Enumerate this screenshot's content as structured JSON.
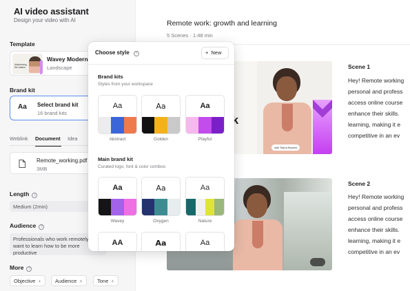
{
  "sidebar": {
    "title": "AI video assistant",
    "subtitle": "Design your video with AI",
    "template": {
      "label": "Template",
      "name": "Wavey Modern",
      "orientation": "Landscape",
      "thumb_text": "Addressing the basics"
    },
    "brand_kit": {
      "label": "Brand kit",
      "aa": "Aa",
      "name": "Select brand kit",
      "count": "16 brand kits"
    },
    "source_tabs": [
      "Weblink",
      "Document",
      "Idea"
    ],
    "active_tab": "Document",
    "file": {
      "name": "Remote_working.pdf",
      "size": "3MB"
    },
    "length": {
      "label": "Length",
      "value": "Medium (2min)"
    },
    "audience": {
      "label": "Audience",
      "value": "Professionals who work remotely and want to learn how to be more productive"
    },
    "more": {
      "label": "More",
      "chips": [
        "Objective",
        "Audience",
        "Tone"
      ]
    }
  },
  "main": {
    "title": "Remote work: growth and learning",
    "meta": "5 Scenes  ·  1:48 min",
    "scenes": [
      {
        "label": "Scene 1",
        "text_lines": [
          "Hey! Remote working",
          "personal and profess",
          "access online course",
          "enhance their skills.",
          "learning, making it e",
          "competitive in an ev"
        ],
        "headline": "rk",
        "name_badge": "with Tasha Bowers"
      },
      {
        "label": "Scene 2",
        "text_lines": [
          "Hey! Remote working",
          "personal and profess",
          "access online course",
          "enhance their skills.",
          "learning, making it e",
          "competitive in an ev"
        ]
      }
    ]
  },
  "popover": {
    "title": "Choose style",
    "new_label": "New",
    "brand_kits": {
      "title": "Brand kits",
      "subtitle": "Styles from your workspace",
      "items": [
        {
          "name": "Abstract",
          "aa": "Aa",
          "colors": [
            "#ececec",
            "#3a66d9",
            "#ef7a4c"
          ]
        },
        {
          "name": "Golden",
          "aa": "Aa",
          "colors": [
            "#111111",
            "#f4b219",
            "#c9c9c9"
          ]
        },
        {
          "name": "Playful",
          "aa": "Aa",
          "colors": [
            "#f7b8ee",
            "#c24cec",
            "#7b1fc8"
          ]
        }
      ]
    },
    "main_brand_kit": {
      "title": "Main brand kit",
      "subtitle": "Curated logo, font & color combos",
      "items": [
        {
          "name": "Wavey",
          "aa": "Aa",
          "colors": [
            "#151515",
            "#a262ea",
            "#ee70e2"
          ]
        },
        {
          "name": "Oxygen",
          "aa": "Aa",
          "colors": [
            "#24336e",
            "#3c8c92",
            "#e7ecee"
          ]
        },
        {
          "name": "Nature",
          "aa": "Aa",
          "colors": [
            "#17686a",
            "#f2f0ec",
            "#dfe534",
            "#9ab87a"
          ]
        }
      ],
      "partial_row": [
        "AA",
        "Aa",
        "Aa"
      ]
    }
  }
}
